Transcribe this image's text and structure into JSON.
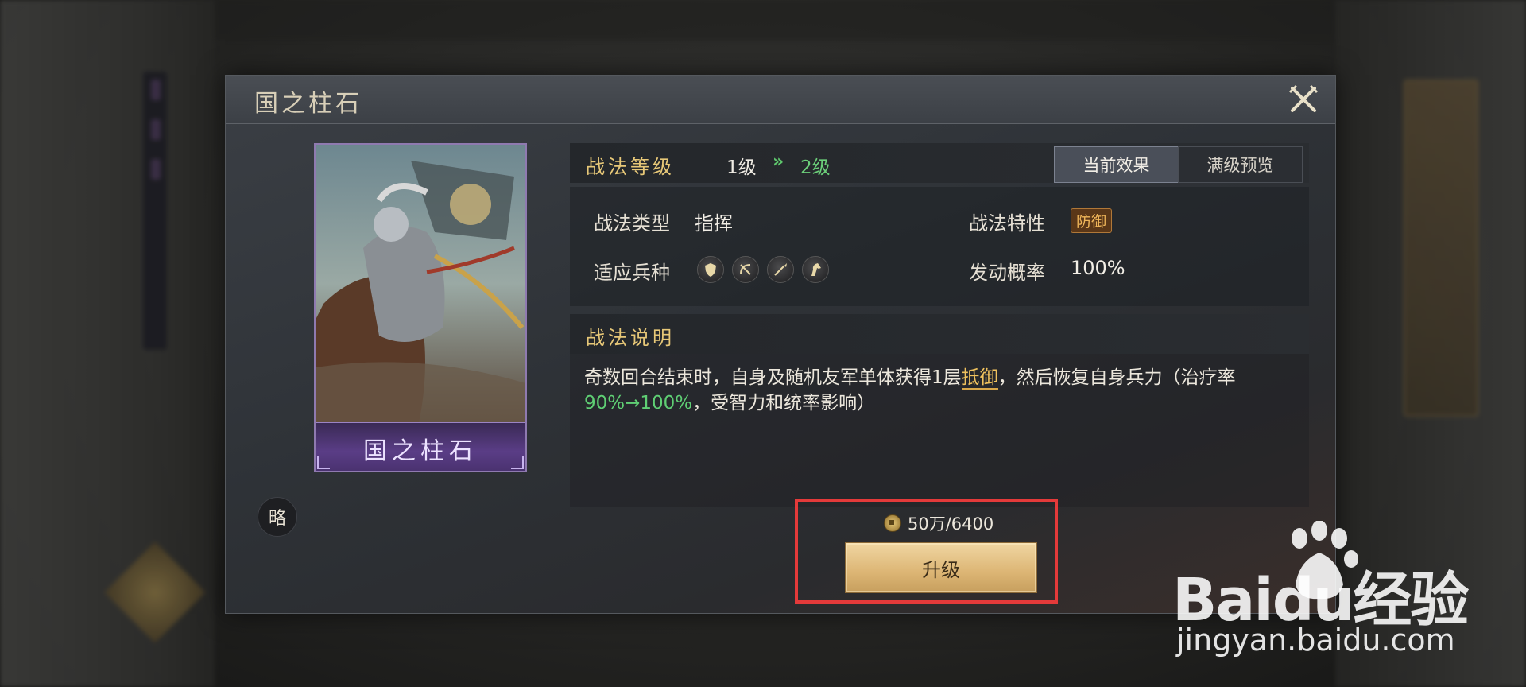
{
  "dialog": {
    "title": "国之柱石",
    "close_icon": "close-crossed-swords-icon"
  },
  "card": {
    "name": "国之柱石",
    "badge": "略"
  },
  "level": {
    "label": "战法等级",
    "from": "1级",
    "arrow": "»",
    "to": "2级"
  },
  "tabs": [
    {
      "label": "当前效果",
      "active": true
    },
    {
      "label": "满级预览",
      "active": false
    }
  ],
  "attributes": {
    "type_label": "战法类型",
    "type_value": "指挥",
    "trait_label": "战法特性",
    "trait_value": "防御",
    "troops_label": "适应兵种",
    "troops": [
      "shield-icon",
      "bow-icon",
      "spear-icon",
      "horse-icon"
    ],
    "rate_label": "发动概率",
    "rate_value": "100%"
  },
  "description": {
    "title": "战法说明",
    "part1": "奇数回合结束时，自身及随机友军单体获得1层",
    "keyword": "抵御",
    "part2": "，然后恢复自身兵力（治疗率",
    "green": "90%→100%",
    "part3": "，受智力和统率影响）"
  },
  "upgrade": {
    "cost": "50万/6400",
    "button_label": "升级"
  },
  "watermark": {
    "brand": "Baidu经验",
    "url": "jingyan.baidu.com"
  },
  "colors": {
    "accent_gold": "#e7c878",
    "green": "#5fcf74",
    "highlight_red": "#e43a3a"
  }
}
